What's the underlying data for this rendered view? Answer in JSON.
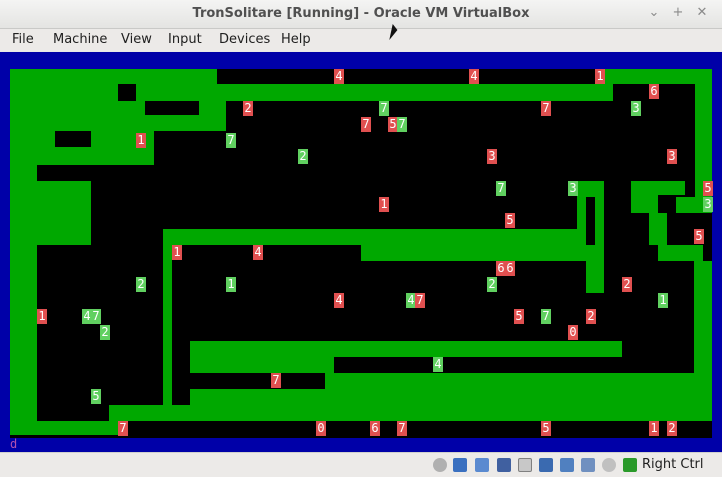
{
  "window": {
    "title": "TronSolitare [Running] - Oracle VM VirtualBox"
  },
  "menu": [
    "File",
    "Machine",
    "View",
    "Input",
    "Devices",
    "Help"
  ],
  "screen": {
    "corner_char": "d"
  },
  "status": {
    "host_key": "Right Ctrl"
  },
  "markers": [
    {
      "t": "4",
      "c": "red"
    },
    {
      "t": "4",
      "c": "red"
    },
    {
      "t": "1",
      "c": "red"
    },
    {
      "t": "6",
      "c": "red"
    },
    {
      "t": "2",
      "c": "red"
    },
    {
      "t": "7",
      "c": "grn"
    },
    {
      "t": "7",
      "c": "red"
    },
    {
      "t": "3",
      "c": "grn"
    },
    {
      "t": "7",
      "c": "red"
    },
    {
      "t": "5",
      "c": "red"
    },
    {
      "t": "7",
      "c": "grn"
    },
    {
      "t": "1",
      "c": "red"
    },
    {
      "t": "7",
      "c": "grn"
    },
    {
      "t": "2",
      "c": "grn"
    },
    {
      "t": "3",
      "c": "red"
    },
    {
      "t": "3",
      "c": "red"
    },
    {
      "t": "7",
      "c": "grn"
    },
    {
      "t": "3",
      "c": "grn"
    },
    {
      "t": "5",
      "c": "red"
    },
    {
      "t": "1",
      "c": "red"
    },
    {
      "t": "5",
      "c": "red"
    },
    {
      "t": "3",
      "c": "grn"
    },
    {
      "t": "5",
      "c": "red"
    },
    {
      "t": "1",
      "c": "red"
    },
    {
      "t": "4",
      "c": "red"
    },
    {
      "t": "6",
      "c": "red"
    },
    {
      "t": "6",
      "c": "red"
    },
    {
      "t": "2",
      "c": "grn"
    },
    {
      "t": "1",
      "c": "grn"
    },
    {
      "t": "2",
      "c": "grn"
    },
    {
      "t": "2",
      "c": "red"
    },
    {
      "t": "4",
      "c": "red"
    },
    {
      "t": "4",
      "c": "grn"
    },
    {
      "t": "7",
      "c": "red"
    },
    {
      "t": "1",
      "c": "grn"
    },
    {
      "t": "1",
      "c": "red"
    },
    {
      "t": "4",
      "c": "grn"
    },
    {
      "t": "7",
      "c": "grn"
    },
    {
      "t": "5",
      "c": "red"
    },
    {
      "t": "7",
      "c": "grn"
    },
    {
      "t": "2",
      "c": "red"
    },
    {
      "t": "2",
      "c": "grn"
    },
    {
      "t": "0",
      "c": "red"
    },
    {
      "t": "4",
      "c": "grn"
    },
    {
      "t": "7",
      "c": "red"
    },
    {
      "t": "5",
      "c": "grn"
    },
    {
      "t": "7",
      "c": "red"
    },
    {
      "t": "0",
      "c": "red"
    },
    {
      "t": "6",
      "c": "red"
    },
    {
      "t": "7",
      "c": "red"
    },
    {
      "t": "5",
      "c": "red"
    },
    {
      "t": "1",
      "c": "red"
    },
    {
      "t": "2",
      "c": "red"
    }
  ]
}
